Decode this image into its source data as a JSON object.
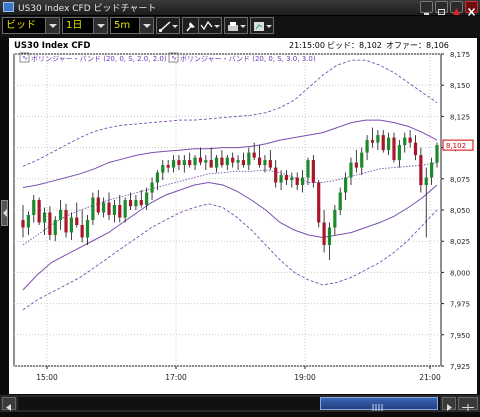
{
  "window": {
    "title": "US30 Index CFD ビッドチャート"
  },
  "toolbar": {
    "price_type": "ビッド",
    "period": "1日",
    "timeframe": "5m",
    "tools": [
      "trendline-icon",
      "pin-icon",
      "indicator-icon",
      "save-chart-icon",
      "export-icon"
    ]
  },
  "chart_header": {
    "symbol": "US30 Index CFD",
    "time": "21:15:00",
    "bid_label": "ビッド：8,102",
    "offer_label": "オファー：8,106"
  },
  "legend": [
    "ボリンジャー・バンド (20, 0, S, 2.0, 2.0)",
    "ボリンジャー・バンド (20, 0, S, 3.0, 3.0)"
  ],
  "price_axis": {
    "ticks": [
      "8,175",
      "8,150",
      "8,125",
      "8,100",
      "8,075",
      "8,050",
      "8,025",
      "8,000",
      "7,975",
      "7,950",
      "7,925"
    ],
    "current_price": "8,102"
  },
  "time_axis": {
    "ticks": [
      "15:00",
      "17:00",
      "19:00",
      "21:00"
    ]
  },
  "colors": {
    "up": "#1c8a2c",
    "down": "#a8162a",
    "band": "#7b4fb0",
    "bg": "#ffffff",
    "price_tag": "#d10000"
  },
  "chart_data": {
    "type": "candlestick",
    "symbol": "US30 Index CFD",
    "timeframe": "5m",
    "x_ticks": [
      "15:00",
      "17:00",
      "19:00",
      "21:00"
    ],
    "ylim": [
      7925,
      8175
    ],
    "grid": true,
    "candles": [
      [
        8042,
        8054,
        8028,
        8036
      ],
      [
        8036,
        8049,
        8030,
        8046
      ],
      [
        8046,
        8062,
        8040,
        8058
      ],
      [
        8058,
        8060,
        8038,
        8040
      ],
      [
        8040,
        8052,
        8030,
        8048
      ],
      [
        8048,
        8053,
        8026,
        8030
      ],
      [
        8030,
        8045,
        8025,
        8042
      ],
      [
        8042,
        8058,
        8034,
        8050
      ],
      [
        8050,
        8055,
        8028,
        8032
      ],
      [
        8032,
        8048,
        8026,
        8044
      ],
      [
        8044,
        8056,
        8036,
        8038
      ],
      [
        8038,
        8050,
        8024,
        8028
      ],
      [
        8028,
        8046,
        8022,
        8042
      ],
      [
        8042,
        8064,
        8038,
        8060
      ],
      [
        8060,
        8066,
        8046,
        8048
      ],
      [
        8048,
        8060,
        8044,
        8056
      ],
      [
        8056,
        8064,
        8042,
        8046
      ],
      [
        8046,
        8058,
        8040,
        8054
      ],
      [
        8054,
        8062,
        8040,
        8044
      ],
      [
        8044,
        8060,
        8040,
        8058
      ],
      [
        8058,
        8064,
        8050,
        8053
      ],
      [
        8053,
        8062,
        8050,
        8058
      ],
      [
        8058,
        8066,
        8052,
        8054
      ],
      [
        8054,
        8068,
        8050,
        8064
      ],
      [
        8064,
        8076,
        8058,
        8072
      ],
      [
        8072,
        8082,
        8066,
        8080
      ],
      [
        8080,
        8090,
        8074,
        8086
      ],
      [
        8086,
        8090,
        8080,
        8084
      ],
      [
        8084,
        8094,
        8080,
        8090
      ],
      [
        8090,
        8094,
        8082,
        8086
      ],
      [
        8086,
        8094,
        8080,
        8090
      ],
      [
        8090,
        8096,
        8084,
        8086
      ],
      [
        8086,
        8094,
        8082,
        8092
      ],
      [
        8092,
        8100,
        8086,
        8088
      ],
      [
        8088,
        8094,
        8082,
        8090
      ],
      [
        8090,
        8100,
        8084,
        8084
      ],
      [
        8084,
        8094,
        8080,
        8092
      ],
      [
        8092,
        8098,
        8084,
        8086
      ],
      [
        8086,
        8094,
        8082,
        8092
      ],
      [
        8092,
        8096,
        8084,
        8088
      ],
      [
        8088,
        8094,
        8082,
        8090
      ],
      [
        8090,
        8096,
        8084,
        8086
      ],
      [
        8086,
        8100,
        8082,
        8096
      ],
      [
        8096,
        8104,
        8090,
        8092
      ],
      [
        8092,
        8102,
        8084,
        8086
      ],
      [
        8086,
        8094,
        8080,
        8090
      ],
      [
        8090,
        8098,
        8082,
        8084
      ],
      [
        8084,
        8090,
        8068,
        8072
      ],
      [
        8072,
        8082,
        8066,
        8078
      ],
      [
        8078,
        8082,
        8070,
        8074
      ],
      [
        8074,
        8080,
        8068,
        8076
      ],
      [
        8076,
        8080,
        8066,
        8070
      ],
      [
        8070,
        8082,
        8064,
        8076
      ],
      [
        8076,
        8092,
        8070,
        8090
      ],
      [
        8090,
        8094,
        8068,
        8072
      ],
      [
        8072,
        8074,
        8036,
        8040
      ],
      [
        8040,
        8050,
        8016,
        8022
      ],
      [
        8022,
        8040,
        8010,
        8036
      ],
      [
        8036,
        8054,
        8030,
        8050
      ],
      [
        8050,
        8068,
        8046,
        8064
      ],
      [
        8064,
        8080,
        8058,
        8076
      ],
      [
        8076,
        8092,
        8070,
        8088
      ],
      [
        8088,
        8098,
        8080,
        8084
      ],
      [
        8084,
        8100,
        8078,
        8096
      ],
      [
        8096,
        8110,
        8090,
        8106
      ],
      [
        8106,
        8116,
        8100,
        8104
      ],
      [
        8104,
        8114,
        8098,
        8110
      ],
      [
        8110,
        8114,
        8096,
        8098
      ],
      [
        8098,
        8112,
        8094,
        8108
      ],
      [
        8108,
        8112,
        8088,
        8090
      ],
      [
        8090,
        8106,
        8084,
        8102
      ],
      [
        8102,
        8112,
        8096,
        8108
      ],
      [
        8108,
        8114,
        8100,
        8104
      ],
      [
        8104,
        8110,
        8090,
        8094
      ],
      [
        8094,
        8100,
        8064,
        8070
      ],
      [
        8070,
        8084,
        8028,
        8076
      ],
      [
        8076,
        8092,
        8070,
        8088
      ],
      [
        8088,
        8104,
        8084,
        8102
      ]
    ],
    "bollinger_2sd": {
      "upper": [
        8068,
        8070,
        8073,
        8076,
        8079,
        8083,
        8088,
        8091,
        8094,
        8096,
        8097,
        8098,
        8099,
        8099,
        8100,
        8100,
        8101,
        8103,
        8106,
        8108,
        8110,
        8112,
        8116,
        8120,
        8122,
        8122,
        8120,
        8117,
        8112,
        8106
      ],
      "middle": [
        8022,
        8030,
        8038,
        8045,
        8050,
        8054,
        8058,
        8061,
        8064,
        8067,
        8070,
        8073,
        8076,
        8079,
        8080,
        8081,
        8081,
        8082,
        8080,
        8076,
        8072,
        8072,
        8074,
        8077,
        8080,
        8083,
        8084,
        8085,
        8086,
        8088
      ],
      "lower": [
        7986,
        7998,
        8008,
        8014,
        8020,
        8026,
        8032,
        8040,
        8048,
        8056,
        8062,
        8066,
        8070,
        8072,
        8070,
        8065,
        8058,
        8050,
        8040,
        8034,
        8030,
        8028,
        8030,
        8032,
        8036,
        8040,
        8045,
        8052,
        8060,
        8070
      ]
    },
    "bollinger_3sd": {
      "upper": [
        8085,
        8090,
        8096,
        8102,
        8108,
        8113,
        8116,
        8118,
        8119,
        8120,
        8121,
        8122,
        8122,
        8123,
        8124,
        8125,
        8126,
        8128,
        8132,
        8138,
        8148,
        8158,
        8166,
        8170,
        8170,
        8166,
        8160,
        8152,
        8144,
        8136
      ],
      "lower": [
        7970,
        7978,
        7984,
        7990,
        7996,
        8004,
        8012,
        8020,
        8028,
        8036,
        8042,
        8048,
        8052,
        8055,
        8052,
        8044,
        8034,
        8022,
        8010,
        8000,
        7994,
        7990,
        7992,
        7996,
        8002,
        8008,
        8016,
        8026,
        8038,
        8050
      ]
    }
  },
  "scrollbar": {
    "position": "right"
  }
}
